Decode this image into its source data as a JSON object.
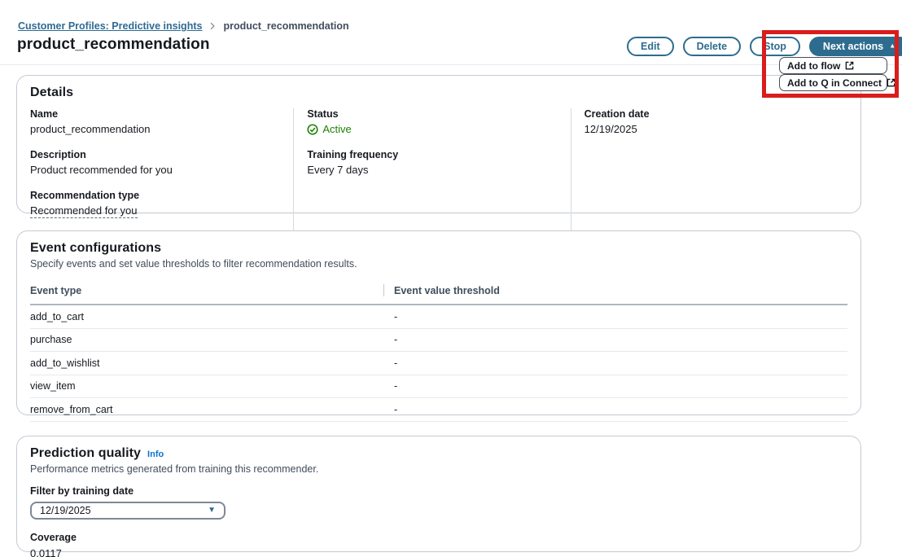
{
  "colors": {
    "accent_blue": "#2d6c8e",
    "link_blue": "#2f6b92",
    "info_link_blue": "#0972d3",
    "status_green": "#1d8102",
    "annotation_red": "#d91c1c"
  },
  "breadcrumb": {
    "link_label": "Customer Profiles: Predictive insights",
    "current": "product_recommendation"
  },
  "header": {
    "title": "product_recommendation",
    "buttons": {
      "edit": "Edit",
      "delete": "Delete",
      "stop": "Stop",
      "next_actions": "Next actions"
    },
    "next_actions_menu": [
      {
        "label": "Add to flow"
      },
      {
        "label": "Add to Q in Connect"
      }
    ]
  },
  "details": {
    "title": "Details",
    "name_label": "Name",
    "name_value": "product_recommendation",
    "description_label": "Description",
    "description_value": "Product recommended for you",
    "recommendation_type_label": "Recommendation type",
    "recommendation_type_value": "Recommended for you",
    "status_label": "Status",
    "status_value": "Active",
    "training_frequency_label": "Training frequency",
    "training_frequency_value": "Every 7 days",
    "creation_date_label": "Creation date",
    "creation_date_value": "12/19/2025"
  },
  "event_configurations": {
    "title": "Event configurations",
    "description": "Specify events and set value thresholds to filter recommendation results.",
    "columns": [
      "Event type",
      "Event value threshold"
    ],
    "rows": [
      {
        "event_type": "add_to_cart",
        "threshold": "-"
      },
      {
        "event_type": "purchase",
        "threshold": "-"
      },
      {
        "event_type": "add_to_wishlist",
        "threshold": "-"
      },
      {
        "event_type": "view_item",
        "threshold": "-"
      },
      {
        "event_type": "remove_from_cart",
        "threshold": "-"
      }
    ]
  },
  "prediction_quality": {
    "title": "Prediction quality",
    "info_link": "Info",
    "description": "Performance metrics generated from training this recommender.",
    "filter_label": "Filter by training date",
    "filter_value": "12/19/2025",
    "coverage_label": "Coverage",
    "coverage_value": "0.0117"
  }
}
